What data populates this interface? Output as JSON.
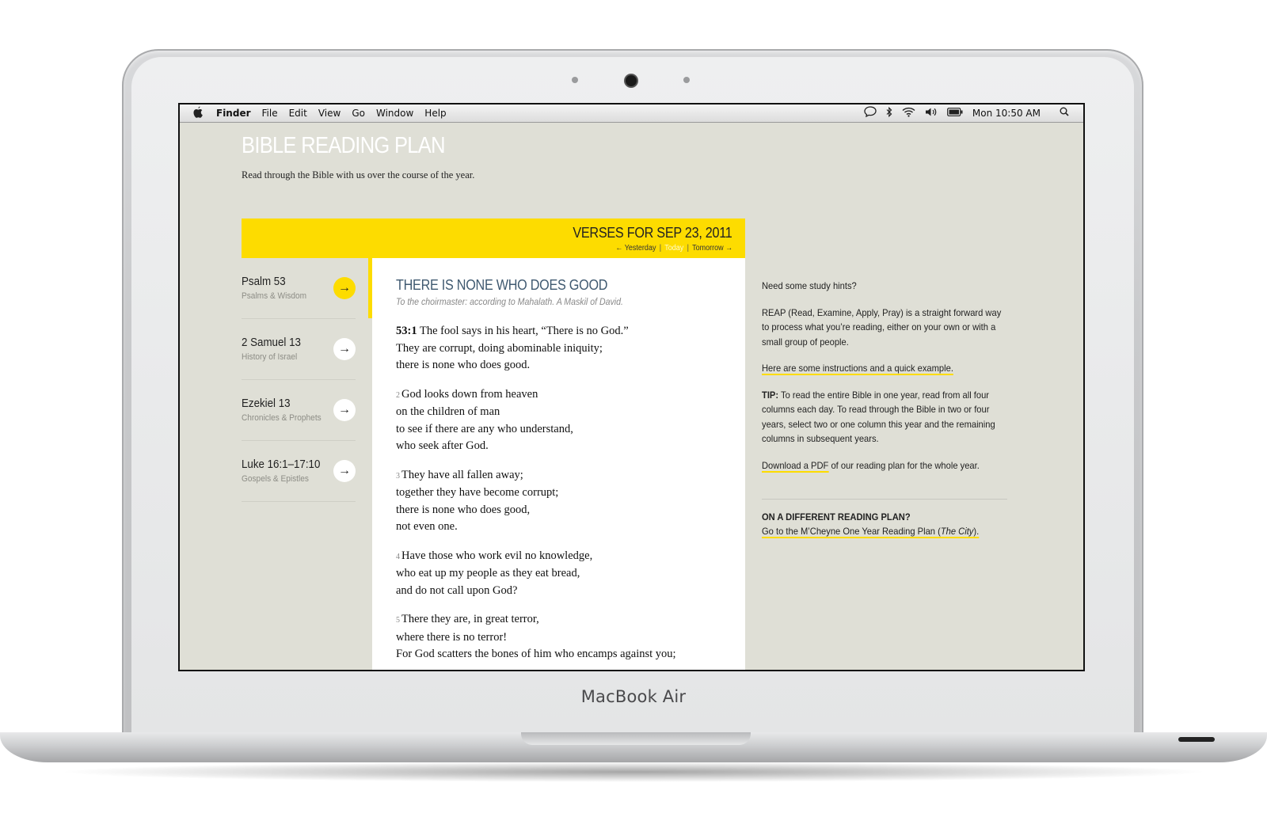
{
  "device": {
    "brand_label": "MacBook Air"
  },
  "menubar": {
    "app_name": "Finder",
    "menus": [
      "File",
      "Edit",
      "View",
      "Go",
      "Window",
      "Help"
    ],
    "clock": "Mon 10:50 AM"
  },
  "site": {
    "title": "BIBLE READING PLAN",
    "subtitle": "Read through the Bible with us over the course of the year."
  },
  "verses_header": {
    "title": "VERSES FOR SEP 23, 2011",
    "nav": {
      "yesterday": "← Yesterday",
      "today": "Today",
      "tomorrow": "Tomorrow →",
      "separator": "|"
    }
  },
  "readings": [
    {
      "ref": "Psalm 53",
      "category": "Psalms & Wisdom",
      "active": true
    },
    {
      "ref": "2 Samuel 13",
      "category": "History of Israel",
      "active": false
    },
    {
      "ref": "Ezekiel 13",
      "category": "Chronicles & Prophets",
      "active": false
    },
    {
      "ref": "Luke 16:1–17:10",
      "category": "Gospels & Epistles",
      "active": false
    }
  ],
  "passage": {
    "title": "THERE IS NONE WHO DOES GOOD",
    "subtitle": "To the choirmaster: according to Mahalath. A Maskil of David.",
    "verses": [
      {
        "num": "53:1",
        "lines": [
          "The fool says in his heart, “There is no God.”",
          "They are corrupt, doing abominable iniquity;",
          "there is none who does good."
        ]
      },
      {
        "num": "2",
        "lines": [
          "God looks down from heaven",
          "on the children of man",
          "to see if there are any who understand,",
          "who seek after God."
        ]
      },
      {
        "num": "3",
        "lines": [
          "They have all fallen away;",
          "together they have become corrupt;",
          "there is none who does good,",
          "not even one."
        ]
      },
      {
        "num": "4",
        "lines": [
          "Have those who work evil no knowledge,",
          "who eat up my people as they eat bread,",
          "and do not call upon God?"
        ]
      },
      {
        "num": "5",
        "lines": [
          "There they are, in great terror,",
          "where there is no terror!",
          "For God scatters the bones of him who encamps against you;"
        ]
      }
    ]
  },
  "sidebar": {
    "hints_heading": "Need some study hints?",
    "reap_text": "REAP (Read, Examine, Apply, Pray) is a straight forward way to process what you’re reading, either on your own or with a small group of people.",
    "instructions_link": "Here are some instructions and a quick example.",
    "tip_label": "TIP:",
    "tip_text": "To read the entire Bible in one year, read from all four columns each day. To read through the Bible in two or four years, select two or one column this year and the remaining columns in subsequent years.",
    "download_link": "Download a PDF",
    "download_rest": " of our reading plan for the whole year.",
    "other_plan_heading": "ON A DIFFERENT READING PLAN?",
    "other_plan_link_prefix": "Go to the M’Cheyne One Year Reading Plan (",
    "other_plan_link_italic": "The City",
    "other_plan_link_suffix": ")."
  },
  "colors": {
    "accent": "#fddc00",
    "page_bg": "#dfdfd6",
    "title_blue": "#3f5970"
  },
  "icons": [
    "apple-icon",
    "message-icon",
    "bluetooth-icon",
    "wifi-icon",
    "volume-icon",
    "battery-icon",
    "spotlight-search-icon",
    "arrow-right-icon"
  ]
}
